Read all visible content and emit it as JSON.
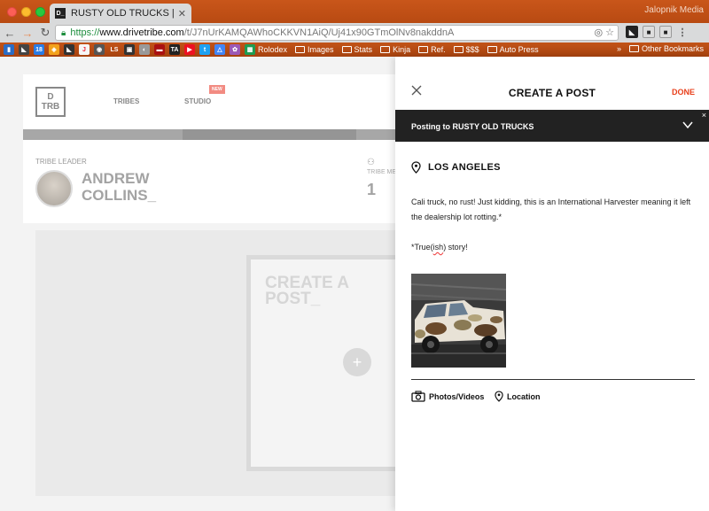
{
  "browser": {
    "tab_title": "RUSTY OLD TRUCKS | DRIVE",
    "tab_favicon": "D_",
    "profile_name": "Jalopnik Media",
    "url_secure": "https://",
    "url_host": "www.drivetribe.com",
    "url_path": "/t/J7nUrKAMQAWhoCKKVN1AiQ/Uj41x90GTmOlNv8nakddnA"
  },
  "bookmarks": {
    "icon_labels": [
      "18",
      "LS",
      "TA"
    ],
    "folders": [
      "Rolodex",
      "Images",
      "Stats",
      "Kinja",
      "Ref.",
      "$$$",
      "Auto Press"
    ],
    "overflow": "»",
    "other": "Other Bookmarks"
  },
  "site": {
    "logo_top": "D",
    "logo_bottom": "TRB",
    "nav_tribes": "TRIBES",
    "nav_studio": "STUDIO",
    "new_badge": "NEW",
    "tribe_leader_label": "TRIBE LEADER",
    "leader_name": "ANDREW\nCOLLINS_",
    "members_label": "TRIBE ME",
    "members_count": "1",
    "create_card_text": "CREATE A\nPOST_",
    "plus": "+"
  },
  "panel": {
    "title": "CREATE A POST",
    "done_label": "DONE",
    "posting_to": "Posting to RUSTY OLD TRUCKS",
    "bar_close": "×",
    "location": "LOS ANGELES",
    "body": "Cali truck, no rust! Just kidding, this is an International Harvester meaning it left the dealership lot rotting.*",
    "footnote_pre": "*True(",
    "footnote_mark": "ish",
    "footnote_post": ") story!",
    "action_photos": "Photos/Videos",
    "action_location": "Location"
  },
  "colors": {
    "accent": "#e8401c",
    "chrome_orange": "#c35418",
    "posting_bar": "#222222"
  }
}
